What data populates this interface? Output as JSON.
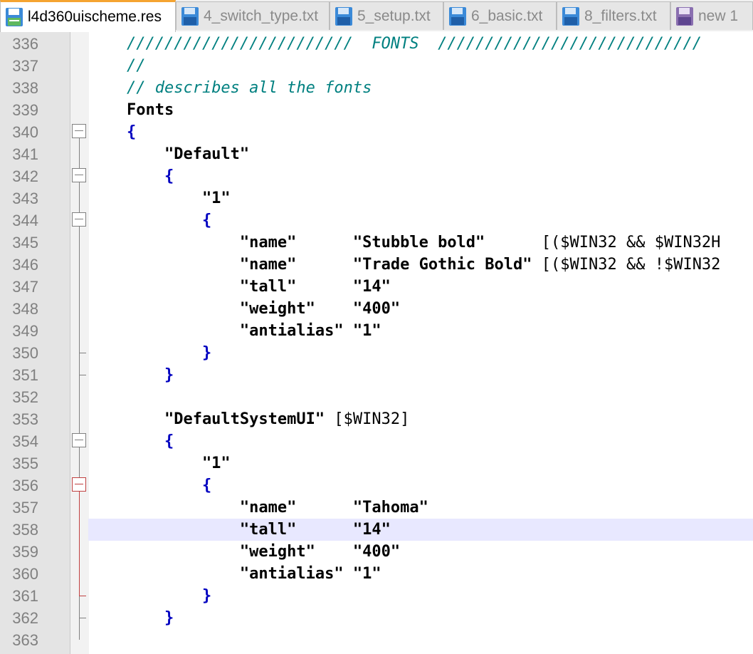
{
  "tabs": [
    {
      "label": "l4d360uischeme.res",
      "active": true,
      "icon": "saved-file-icon",
      "icon_color": "#5fb85f"
    },
    {
      "label": "4_switch_type.txt",
      "active": false,
      "icon": "save-disk-icon",
      "icon_color": "#3b8ad8"
    },
    {
      "label": "5_setup.txt",
      "active": false,
      "icon": "save-disk-icon",
      "icon_color": "#3b8ad8"
    },
    {
      "label": "6_basic.txt",
      "active": false,
      "icon": "save-disk-icon",
      "icon_color": "#3b8ad8"
    },
    {
      "label": "8_filters.txt",
      "active": false,
      "icon": "save-disk-icon",
      "icon_color": "#3b8ad8"
    },
    {
      "label": "new 1",
      "active": false,
      "icon": "unsaved-disk-icon",
      "icon_color": "#8a6fb0"
    }
  ],
  "colors": {
    "tab_accent": "#f5a431",
    "comment": "#008080",
    "brace": "#0000c0",
    "current_line": "#e8e8ff",
    "fold_active": "#c04040"
  },
  "editor": {
    "current_line": 358,
    "lines": [
      {
        "num": "336",
        "text": "    ////////////////////////  FONTS  ////////////////////////////"
      },
      {
        "num": "337",
        "text": "    //"
      },
      {
        "num": "338",
        "text": "    // describes all the fonts"
      },
      {
        "num": "339",
        "text": "    Fonts"
      },
      {
        "num": "340",
        "text": "    {"
      },
      {
        "num": "341",
        "text": "        \"Default\""
      },
      {
        "num": "342",
        "text": "        {"
      },
      {
        "num": "343",
        "text": "            \"1\""
      },
      {
        "num": "344",
        "text": "            {"
      },
      {
        "num": "345",
        "text": "                \"name\"      \"Stubble bold\"      [($WIN32 && $WIN32H"
      },
      {
        "num": "346",
        "text": "                \"name\"      \"Trade Gothic Bold\" [($WIN32 && !$WIN32"
      },
      {
        "num": "347",
        "text": "                \"tall\"      \"14\""
      },
      {
        "num": "348",
        "text": "                \"weight\"    \"400\""
      },
      {
        "num": "349",
        "text": "                \"antialias\" \"1\""
      },
      {
        "num": "350",
        "text": "            }"
      },
      {
        "num": "351",
        "text": "        }"
      },
      {
        "num": "352",
        "text": ""
      },
      {
        "num": "353",
        "text": "        \"DefaultSystemUI\" [$WIN32]"
      },
      {
        "num": "354",
        "text": "        {"
      },
      {
        "num": "355",
        "text": "            \"1\""
      },
      {
        "num": "356",
        "text": "            {"
      },
      {
        "num": "357",
        "text": "                \"name\"      \"Tahoma\""
      },
      {
        "num": "358",
        "text": "                \"tall\"      \"14\""
      },
      {
        "num": "359",
        "text": "                \"weight\"    \"400\""
      },
      {
        "num": "360",
        "text": "                \"antialias\" \"1\""
      },
      {
        "num": "361",
        "text": "            }"
      },
      {
        "num": "362",
        "text": "        }"
      },
      {
        "num": "363",
        "text": ""
      }
    ]
  }
}
